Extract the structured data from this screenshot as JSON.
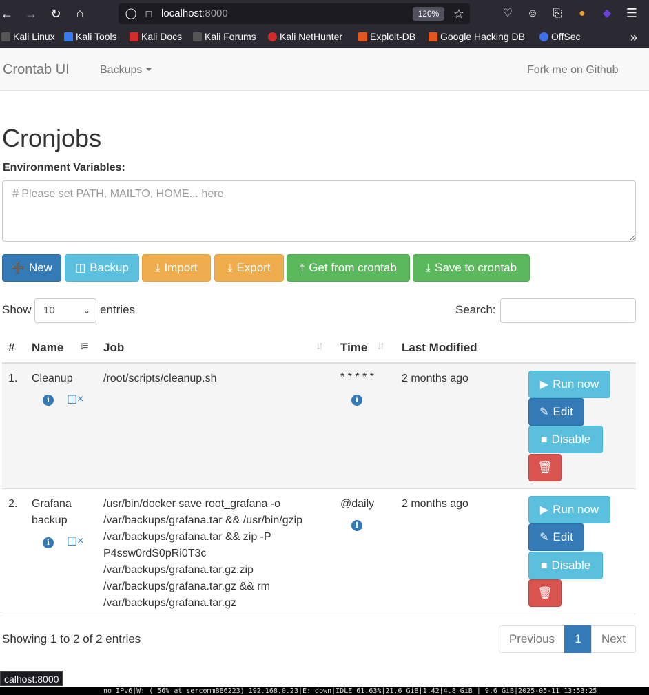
{
  "browser": {
    "url_host": "localhost",
    "url_port": ":8000",
    "zoom": "120%",
    "bookmarks": [
      {
        "label": "Kali Linux",
        "color": "#367bf0"
      },
      {
        "label": "Kali Tools",
        "color": "#e0344f"
      },
      {
        "label": "Kali Docs",
        "color": "#d22b2b"
      },
      {
        "label": "Kali Forums",
        "color": "#367bf0"
      },
      {
        "label": "Kali NetHunter",
        "color": "#d22b2b"
      },
      {
        "label": "Exploit-DB",
        "color": "#e5561d"
      },
      {
        "label": "Google Hacking DB",
        "color": "#e5561d"
      },
      {
        "label": "OffSec",
        "color": "#3a6ff0"
      }
    ]
  },
  "navbar": {
    "brand": "Crontab UI",
    "backups_label": "Backups",
    "fork_label": "Fork me on Github"
  },
  "page": {
    "title": "Cronjobs",
    "env_label": "Environment Variables:",
    "env_placeholder": "# Please set PATH, MAILTO, HOME... here"
  },
  "toolbar": {
    "new": "New",
    "backup": "Backup",
    "import": "Import",
    "export": "Export",
    "get_crontab": "Get from crontab",
    "save_crontab": "Save to crontab"
  },
  "datatable": {
    "show_label": "Show",
    "page_length": "10",
    "entries_label": "entries",
    "search_label": "Search:",
    "columns": [
      "#",
      "Name",
      "Job",
      "Time",
      "Last Modified"
    ],
    "rows": [
      {
        "num": "1.",
        "name": "Cleanup",
        "job": "/root/scripts/cleanup.sh",
        "time": "* * * * *",
        "modified": "2 months ago"
      },
      {
        "num": "2.",
        "name": "Grafana backup",
        "job": "/usr/bin/docker save root_grafana -o /var/backups/grafana.tar && /usr/bin/gzip /var/backups/grafana.tar && zip -P P4ssw0rdS0pRi0T3c /var/backups/grafana.tar.gz.zip /var/backups/grafana.tar.gz && rm /var/backups/grafana.tar.gz",
        "time": "@daily",
        "modified": "2 months ago"
      }
    ],
    "row_actions": {
      "run": "Run now",
      "edit": "Edit",
      "disable": "Disable"
    },
    "info": "Showing 1 to 2 of 2 entries",
    "pagination": {
      "previous": "Previous",
      "current": "1",
      "next": "Next"
    }
  },
  "status_url": "calhost:8000",
  "sysbar": "no IPv6|W: ( 56% at sercommBB6223) 192.168.0.23|E: down|IDLE 61.63%|21.6 GiB|1.42|4.8 GiB | 9.6 GiB|2025-05-11 13:53:25"
}
